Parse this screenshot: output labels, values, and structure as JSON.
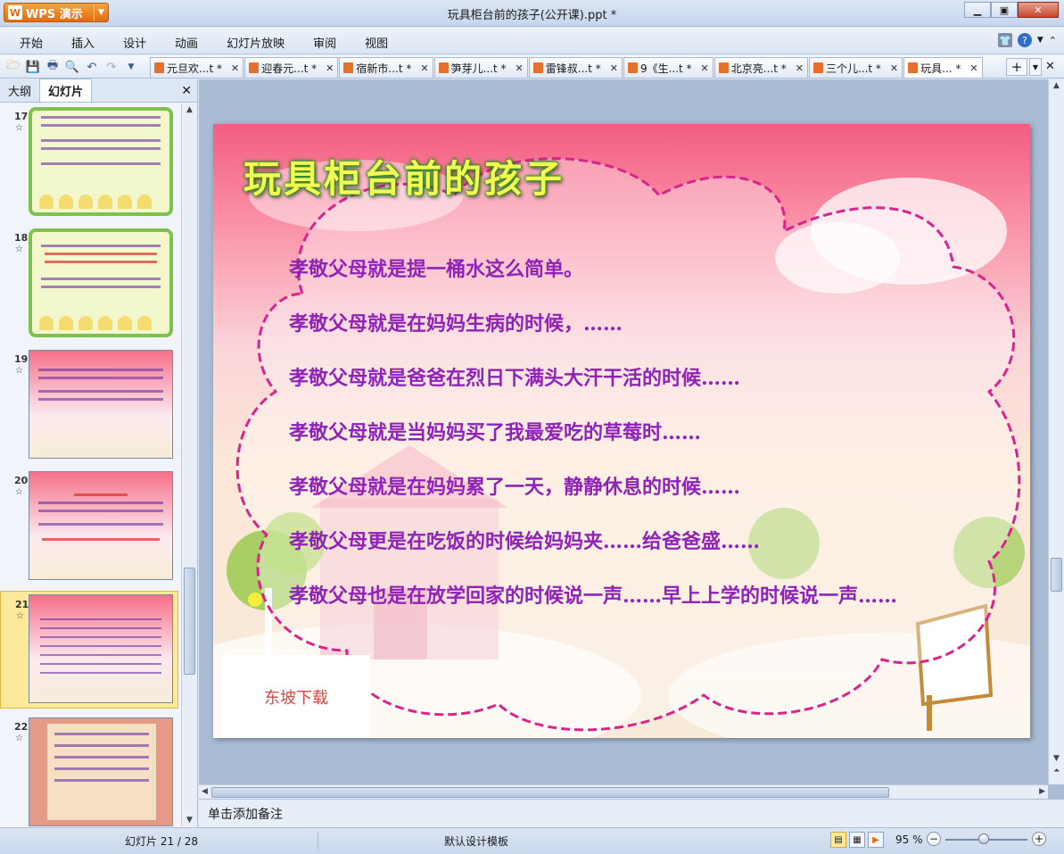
{
  "app": {
    "name": "WPS 演示",
    "window_title": "玩具柜台前的孩子(公开课).ppt *"
  },
  "menu": [
    "开始",
    "插入",
    "设计",
    "动画",
    "幻灯片放映",
    "审阅",
    "视图"
  ],
  "tabs": [
    {
      "label": "元旦欢...t *"
    },
    {
      "label": "迎春元...t *"
    },
    {
      "label": "宿新市...t *"
    },
    {
      "label": "笋芽儿...t *"
    },
    {
      "label": "雷锋叔...t *"
    },
    {
      "label": "9《生...t *"
    },
    {
      "label": "北京亮...t *"
    },
    {
      "label": "三个儿...t *"
    },
    {
      "label": "玩具... *"
    }
  ],
  "panel": {
    "tab_outline": "大纲",
    "tab_slides": "幻灯片",
    "thumbnails": [
      {
        "num": "17",
        "star": "☆"
      },
      {
        "num": "18",
        "star": "☆"
      },
      {
        "num": "19",
        "star": "☆"
      },
      {
        "num": "20",
        "star": "☆"
      },
      {
        "num": "21",
        "star": "☆"
      },
      {
        "num": "22",
        "star": "☆"
      }
    ],
    "selected_slide": 21
  },
  "slide": {
    "title": "玩具柜台前的孩子",
    "lines": [
      "孝敬父母就是提一桶水这么简单。",
      "孝敬父母就是在妈妈生病的时候，……",
      "孝敬父母就是爸爸在烈日下满头大汗干活的时候……",
      "孝敬父母就是当妈妈买了我最爱吃的草莓时……",
      "孝敬父母就是在妈妈累了一天，静静休息的时候……",
      "孝敬父母更是在吃饭的时候给妈妈夹……给爸爸盛……",
      "孝敬父母也是在放学回家的时候说一声……早上上学的时候说一声……"
    ],
    "watermark": "东坡下载"
  },
  "notes_placeholder": "单击添加备注",
  "status": {
    "slide_counter": "幻灯片 21 / 28",
    "template": "默认设计模板",
    "zoom": "95 %"
  }
}
